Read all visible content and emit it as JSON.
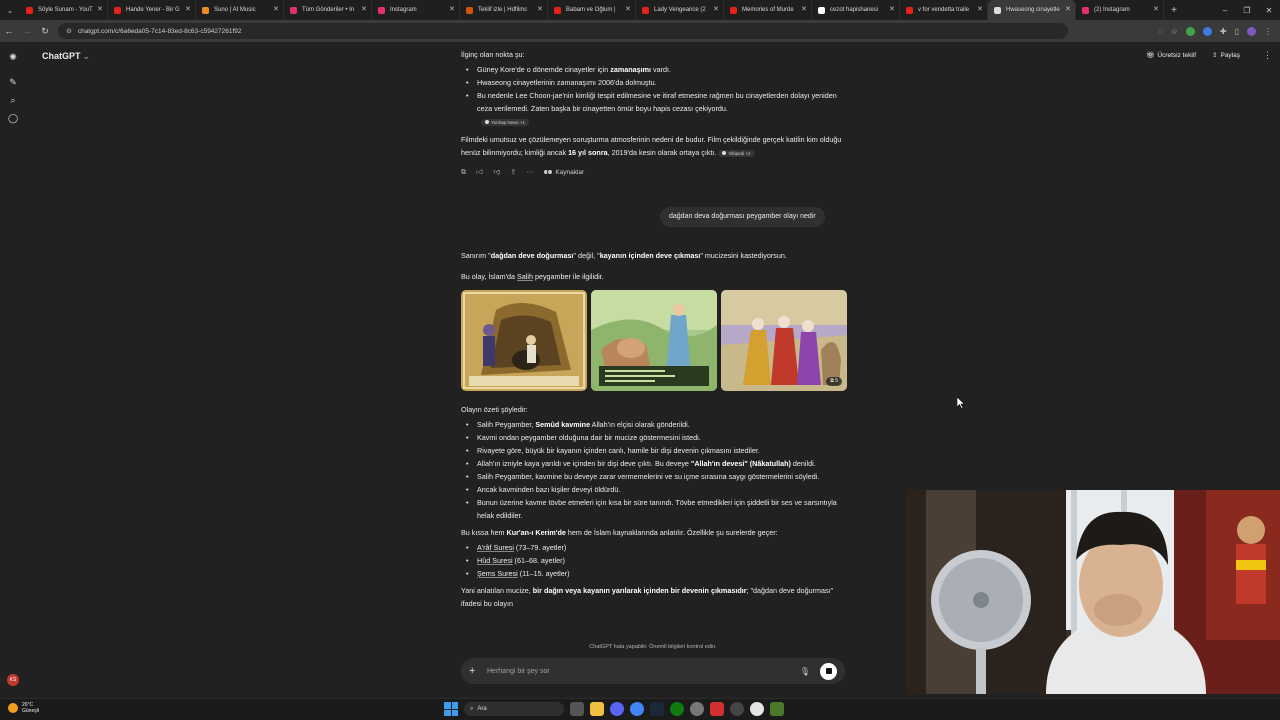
{
  "browser": {
    "tabs": [
      {
        "title": "Söyle Sunam - YouT",
        "color": "#e62117",
        "active": false
      },
      {
        "title": "Hande Yener - Bir G",
        "color": "#e62117",
        "active": false
      },
      {
        "title": "Suno | AI Music",
        "color": "#f08a24",
        "active": false
      },
      {
        "title": "Tüm Gönderiler • In",
        "color": "#e1306c",
        "active": false
      },
      {
        "title": "Instagram",
        "color": "#e1306c",
        "active": false
      },
      {
        "title": "Teklif izle | Hdfilmc",
        "color": "#d35400",
        "active": false
      },
      {
        "title": "Babam ve Oğlum |",
        "color": "#e62117",
        "active": false
      },
      {
        "title": "Lady Vengeance (2",
        "color": "#e62117",
        "active": false
      },
      {
        "title": "Memories of Murde",
        "color": "#e62117",
        "active": false
      },
      {
        "title": "cezot hapishanesi",
        "color": "#ffffff",
        "active": false
      },
      {
        "title": "v for vendetta traile",
        "color": "#e62117",
        "active": false
      },
      {
        "title": "Hwaseong cinayetle",
        "color": "#dddddd",
        "active": true
      },
      {
        "title": "(2) Instagram",
        "color": "#e1306c",
        "active": false
      }
    ],
    "url": "chatgpt.com/c/6a6eda05-7c14-83ed-8c63-c59427261f92"
  },
  "app": {
    "title": "ChatGPT",
    "offer_label": "Ücretsiz teklif",
    "share_label": "Paylaş",
    "avatar_initials": "KS"
  },
  "conversation": {
    "intro": "İlginç olan nokta şu:",
    "bullets1": [
      {
        "pre": "Güney Kore'de o dönemde cinayetler için ",
        "bold": "zamanaşımı",
        "post": " vardı."
      },
      {
        "pre": "Hwaseong cinayetlerinin zamanaşımı 2006'da dolmuştu.",
        "bold": "",
        "post": ""
      },
      {
        "pre": "Bu nedenle Lee Choon-jae'nin kimliği tespit edilmesine ve itiraf etmesine rağmen bu cinayetlerden dolayı yeniden ceza verilemedi. Zaten başka bir cinayetten ömür boyu hapis cezası çekiyordu.",
        "bold": "",
        "post": ""
      }
    ],
    "source_chip_1": "Yonhap News +1",
    "para1_pre": "Filmdeki umutsuz ve çözülemeyen soruşturma atmosferinin nedeni de budur. Film çekildiğinde gerçek katilin kim olduğu henüz bilinmiyordu; kimliği ancak ",
    "para1_bold": "16 yıl sonra",
    "para1_post": ", 2019'da kesin olarak ortaya çıktı.",
    "source_chip_2": "Vikipedi +2",
    "sources_label": "Kaynaklar",
    "user_message": "dağdan deva doğurması peygamber olayı nedir",
    "answer_line1_pre": "Sanırım \"",
    "answer_line1_b1": "dağdan deve doğurması",
    "answer_line1_mid": "\" değil, \"",
    "answer_line1_b2": "kayanın içinden deve çıkması",
    "answer_line1_post": "\" mucizesini kastediyorsun.",
    "answer_line2_pre": "Bu olay, İslam'da ",
    "answer_line2_link": "Salih",
    "answer_line2_post": " peygamber ile ilgilidir.",
    "image_count": "5",
    "summary_title": "Olayın özeti şöyledir:",
    "bullets2": [
      {
        "pre": "Salih Peygamber, ",
        "bold": "Semûd kavmine",
        "post": " Allah'ın elçisi olarak gönderildi."
      },
      {
        "pre": "Kavmi ondan peygamber olduğuna dair bir mucize göstermesini istedi.",
        "bold": "",
        "post": ""
      },
      {
        "pre": "Rivayete göre, büyük bir kayanın içinden canlı, hamile bir dişi devenin çıkmasını istediler.",
        "bold": "",
        "post": ""
      },
      {
        "pre": "Allah'ın izniyle kaya yarıldı ve içinden bir dişi deve çıktı. Bu deveye ",
        "bold": "\"Allah'ın devesi\" (Nâkatullah)",
        "post": " denildi."
      },
      {
        "pre": "Salih Peygamber, kavmine bu deveye zarar vermemelerini ve su içme sırasına saygı göstermelerini söyledi.",
        "bold": "",
        "post": ""
      },
      {
        "pre": "Ancak kavminden bazı kişiler deveyi öldürdü.",
        "bold": "",
        "post": ""
      },
      {
        "pre": "Bunun üzerine kavme tövbe etmeleri için kısa bir süre tanındı. Tövbe etmedikleri için şiddetli bir ses ve sarsıntıyla helak edildiler.",
        "bold": "",
        "post": ""
      }
    ],
    "quran_pre": "Bu kıssa hem ",
    "quran_bold": "Kur'an-ı Kerim'de",
    "quran_post": " hem de İslam kaynaklarında anlatılır. Özellikle şu surelerde geçer:",
    "surahs": [
      {
        "name": "A'râf Suresi",
        "verses": " (73–79. ayetler)"
      },
      {
        "name": "Hûd Suresi",
        "verses": " (61–68. ayetler)"
      },
      {
        "name": "Şems Suresi",
        "verses": " (11–15. ayetler)"
      }
    ],
    "final_pre": "Yani anlatılan mucize, ",
    "final_bold": "bir dağın veya kayanın yarılarak içinden bir devenin çıkmasıdır",
    "final_post": "; \"dağdan deve doğurması\" ifadesi bu olayın"
  },
  "footer_note": "ChatGPT hata yapabilir. Önemli bilgileri kontrol edin.",
  "composer": {
    "placeholder": "Herhangi bir şey sor"
  },
  "taskbar": {
    "temperature": "26°C",
    "weather": "Güneşli",
    "search_label": "Ara"
  }
}
